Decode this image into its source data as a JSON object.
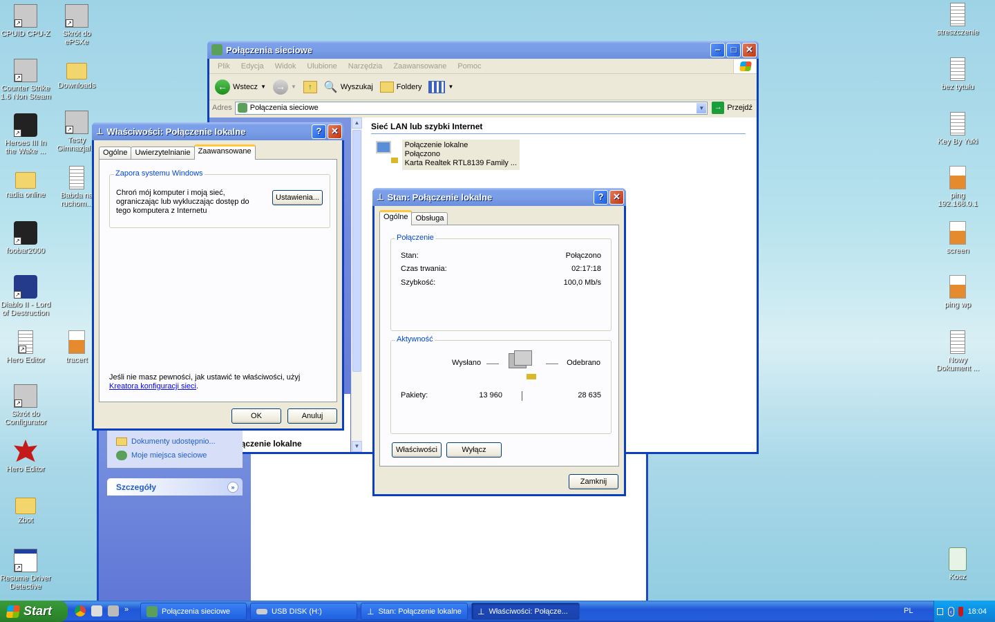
{
  "desktop": {
    "left_icons": [
      {
        "label": "CPUID CPU-Z",
        "icon": "cpu-z-icon"
      },
      {
        "label": "Skrót do ePSXe",
        "icon": "gamepad-icon"
      },
      {
        "label": "Counter Strike 1.6 Non Steam",
        "icon": "counter-strike-icon"
      },
      {
        "label": "Downloads",
        "icon": "folder-icon"
      },
      {
        "label": "Heroes III In the Wake ...",
        "icon": "heroes-icon"
      },
      {
        "label": "Testy Gimnazjal...",
        "icon": "tests-icon"
      },
      {
        "label": "radia online",
        "icon": "folder-icon"
      },
      {
        "label": "Babda na ruchom...",
        "icon": "film-icon"
      },
      {
        "label": "foobar2000",
        "icon": "foobar-icon"
      },
      {
        "label": "Diablo II - Lord of Destruction",
        "icon": "diablo-icon"
      },
      {
        "label": "Hero Editor",
        "icon": "hero-editor-icon"
      },
      {
        "label": "tracert",
        "icon": "paint-image-icon"
      },
      {
        "label": "Skrót do Configurator",
        "icon": "configurator-icon"
      },
      {
        "label": "Hero Editor",
        "icon": "maple-leaf-icon"
      },
      {
        "label": "Zbot",
        "icon": "folder-icon"
      },
      {
        "label": "Resume Driver Detective",
        "icon": "app-window-icon"
      }
    ],
    "right_icons": [
      {
        "label": "streszczenie",
        "icon": "text-file-icon"
      },
      {
        "label": "bez tytułu",
        "icon": "paint-icon"
      },
      {
        "label": "Key By Yuki",
        "icon": "text-file-icon"
      },
      {
        "label": "ping 192.168.0.1",
        "icon": "paint-image-icon"
      },
      {
        "label": "screen",
        "icon": "paint-image-icon"
      },
      {
        "label": "ping wp",
        "icon": "paint-image-icon"
      },
      {
        "label": "Nowy Dokument ...",
        "icon": "text-file-icon"
      },
      {
        "label": "Kosz",
        "icon": "recycle-bin-icon"
      }
    ]
  },
  "explorer": {
    "title": "Połączenia sieciowe",
    "menu": [
      "Plik",
      "Edycja",
      "Widok",
      "Ulubione",
      "Narzędzia",
      "Zaawansowane",
      "Pomoc"
    ],
    "toolbar": {
      "back": "Wstecz",
      "search": "Wyszukaj",
      "folders": "Foldery"
    },
    "address_label": "Adres",
    "address_value": "Połączenia sieciowe",
    "go_label": "Przejdź",
    "section_title": "Sieć LAN lub szybki Internet",
    "connection": {
      "name": "Połączenie lokalne",
      "status": "Połączono",
      "adapter": "Karta Realtek RTL8139 Family ..."
    },
    "sidebar_links": [
      "Dokumenty udostępnio...",
      "Moje miejsca sieciowe"
    ],
    "details_title": "Szczegóły",
    "details_item": "Połączenie lokalne"
  },
  "properties": {
    "title": "Właściwości: Połączenie lokalne",
    "tabs": [
      "Ogólne",
      "Uwierzytelnianie",
      "Zaawansowane"
    ],
    "group_title": "Zapora systemu Windows",
    "group_text": "Chroń mój komputer i moją sieć, ograniczając lub wykluczając dostęp do tego komputera z Internetu",
    "settings_btn": "Ustawienia...",
    "footer_text": "Jeśli nie masz pewności, jak ustawić te właściwości, użyj",
    "footer_link": "Kreatora konfiguracji sieci",
    "footer_end": ".",
    "ok": "OK",
    "cancel": "Anuluj"
  },
  "status": {
    "title": "Stan: Połączenie lokalne",
    "tabs": [
      "Ogólne",
      "Obsługa"
    ],
    "connection_group": "Połączenie",
    "rows": [
      {
        "label": "Stan:",
        "value": "Połączono"
      },
      {
        "label": "Czas trwania:",
        "value": "02:17:18"
      },
      {
        "label": "Szybkość:",
        "value": "100,0 Mb/s"
      }
    ],
    "activity_group": "Aktywność",
    "sent_label": "Wysłano",
    "received_label": "Odebrano",
    "packets_label": "Pakiety:",
    "packets_sent": "13 960",
    "packets_received": "28 635",
    "properties_btn": "Właściwości",
    "disable_btn": "Wyłącz",
    "close_btn": "Zamknij"
  },
  "taskbar": {
    "start": "Start",
    "items": [
      {
        "label": "Połączenia sieciowe",
        "icon": "network-connections-icon"
      },
      {
        "label": "USB DISK (H:)",
        "icon": "usb-drive-icon"
      },
      {
        "label": "Stan: Połączenie lokalne",
        "icon": "network-icon"
      },
      {
        "label": "Właściwości: Połącze...",
        "icon": "network-icon"
      }
    ],
    "language": "PL",
    "clock": "18:04"
  }
}
